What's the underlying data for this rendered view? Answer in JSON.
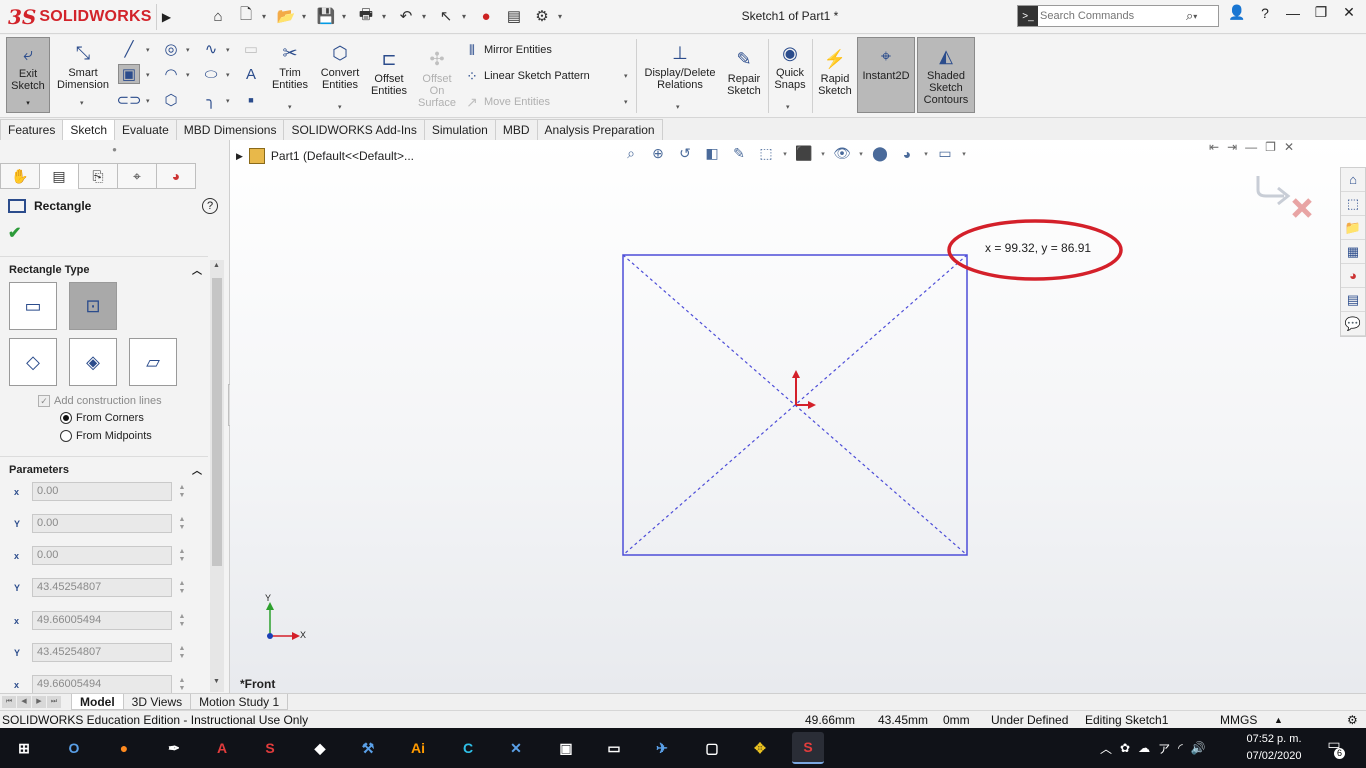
{
  "app": {
    "logo_prefix": "3S",
    "logo_brand": "SOLIDWORKS",
    "document_title": "Sketch1 of Part1 *"
  },
  "search": {
    "placeholder": "Search Commands"
  },
  "ribbon": {
    "exit_sketch": "Exit Sketch",
    "smart_dimension": "Smart Dimension",
    "trim_entities": "Trim Entities",
    "convert_entities": "Convert Entities",
    "offset_entities": "Offset Entities",
    "offset_on_surface": "Offset On Surface",
    "mirror_entities": "Mirror Entities",
    "linear_sketch_pattern": "Linear Sketch Pattern",
    "move_entities": "Move Entities",
    "display_delete_relations": "Display/Delete Relations",
    "repair_sketch": "Repair Sketch",
    "quick_snaps": "Quick Snaps",
    "rapid_sketch": "Rapid Sketch",
    "instant2d": "Instant2D",
    "shaded_sketch_contours": "Shaded Sketch Contours"
  },
  "tabs": [
    "Features",
    "Sketch",
    "Evaluate",
    "MBD Dimensions",
    "SOLIDWORKS Add-Ins",
    "Simulation",
    "MBD",
    "Analysis Preparation"
  ],
  "tree": {
    "part_label": "Part1  (Default<<Default>..."
  },
  "property_manager": {
    "title": "Rectangle",
    "help": "?",
    "ok": "✔",
    "rectangle_type_header": "Rectangle Type",
    "add_construction_lines": "Add construction lines",
    "from_corners": "From Corners",
    "from_midpoints": "From Midpoints",
    "parameters_header": "Parameters",
    "parameters": [
      {
        "axis": "x",
        "value": "0.00"
      },
      {
        "axis": "Y",
        "value": "0.00"
      },
      {
        "axis": "x",
        "value": "0.00"
      },
      {
        "axis": "Y",
        "value": "43.45254807"
      },
      {
        "axis": "x",
        "value": "49.66005494"
      },
      {
        "axis": "Y",
        "value": "43.45254807"
      },
      {
        "axis": "x",
        "value": "49.66005494"
      }
    ]
  },
  "graphics": {
    "coordinate_readout": "x = 99.32, y = 86.91",
    "view_label": "*Front",
    "triad_x": "X",
    "triad_y": "Y",
    "colors": {
      "sketch_line": "#4d4dd8",
      "highlight_ellipse": "#d4202a",
      "origin": "#d4202a"
    }
  },
  "bottom_tabs": [
    "Model",
    "3D Views",
    "Motion Study 1"
  ],
  "status": {
    "edition": "SOLIDWORKS Education Edition - Instructional Use Only",
    "x_value": "49.66mm",
    "y_value": "43.45mm",
    "z_value": "0mm",
    "state": "Under Defined",
    "editing": "Editing Sketch1",
    "units": "MMGS"
  },
  "taskbar": {
    "time": "07:52 p. m.",
    "date": "07/02/2020",
    "notifications": "6"
  }
}
